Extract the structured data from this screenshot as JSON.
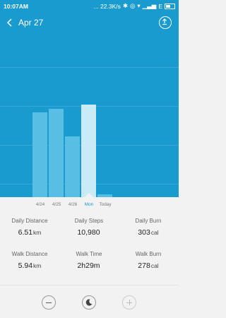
{
  "status": {
    "time": "10:07AM",
    "network_speed": "... 22.3K/s",
    "carrier": "E"
  },
  "header": {
    "title": "Apr 27",
    "back_icon": "chevron-left-icon",
    "share_icon": "share-icon"
  },
  "chart_data": {
    "type": "bar",
    "categories": [
      "4/24",
      "4/25",
      "4/26",
      "Mon",
      "Today"
    ],
    "values": [
      0.63,
      0.66,
      0.45,
      0.69,
      0.02
    ],
    "selected_index": 3,
    "title": "",
    "xlabel": "",
    "ylabel": "",
    "ylim": [
      0,
      1
    ],
    "grid": true
  },
  "stats": [
    {
      "label": "Daily Distance",
      "value": "6.51",
      "unit": "km"
    },
    {
      "label": "Daily Steps",
      "value": "10,980",
      "unit": ""
    },
    {
      "label": "Daily Burn",
      "value": "303",
      "unit": "cal"
    },
    {
      "label": "Walk Distance",
      "value": "5.94",
      "unit": "km"
    },
    {
      "label": "Walk Time",
      "value": "2h29m",
      "unit": ""
    },
    {
      "label": "Walk Burn",
      "value": "278",
      "unit": "cal"
    }
  ],
  "controls": {
    "minus_icon": "minus-icon",
    "moon_icon": "moon-icon",
    "plus_icon": "plus-icon"
  },
  "colors": {
    "chart_bg": "#1a9bd0",
    "bar": "#58bee4",
    "bar_selected": "#c9eaf7"
  }
}
